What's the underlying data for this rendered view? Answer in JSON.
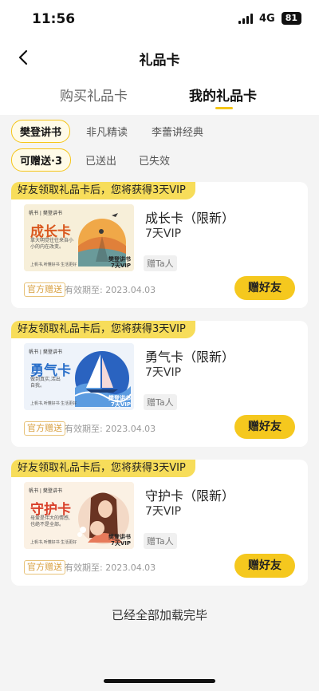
{
  "status_bar": {
    "time": "11:56",
    "network": "4G",
    "battery": "81"
  },
  "header": {
    "title": "礼品卡",
    "back_icon": "chevron-left-icon"
  },
  "main_tabs": [
    {
      "label": "购买礼品卡",
      "active": false
    },
    {
      "label": "我的礼品卡",
      "active": true
    }
  ],
  "source_filters": [
    {
      "label": "樊登讲书",
      "active": true
    },
    {
      "label": "非凡精读",
      "active": false
    },
    {
      "label": "李蕾讲经典",
      "active": false
    }
  ],
  "status_filters": [
    {
      "label": "可赠送·3",
      "active": true
    },
    {
      "label": "已送出",
      "active": false
    },
    {
      "label": "已失效",
      "active": false
    }
  ],
  "cards": [
    {
      "banner": "好友领取礼品卡后，您将获得3天VIP",
      "name": "成长卡（限新）",
      "duration": "7天VIP",
      "gift_tag": "赠Ta人",
      "official_tag": "官方赠送",
      "expiry": "有效期至: 2023.04.03",
      "button": "赠好友",
      "thumb_title": "成长卡",
      "thumb_brand": "帆书 | 樊登讲书",
      "thumb_sub": "拿大明觉往往来自小小的内在改变。",
      "thumb_corner": "樊登讲书\n7天VIP",
      "thumb_footer": "上帆书,听懂好书 生活更好",
      "accent": "#d9571e"
    },
    {
      "banner": "好友领取礼品卡后，您将获得3天VIP",
      "name": "勇气卡（限新）",
      "duration": "7天VIP",
      "gift_tag": "赠Ta人",
      "official_tag": "官方赠送",
      "expiry": "有效期至: 2023.04.03",
      "button": "赠好友",
      "thumb_title": "勇气卡",
      "thumb_brand": "帆书 | 樊登讲书",
      "thumb_sub": "做到真实,活出自我。",
      "thumb_corner": "樊登讲书\n7天VIP",
      "thumb_footer": "上帆书,听懂好书 生活更好",
      "accent": "#2a6fc9"
    },
    {
      "banner": "好友领取礼品卡后，您将获得3天VIP",
      "name": "守护卡（限新）",
      "duration": "7天VIP",
      "gift_tag": "赠Ta人",
      "official_tag": "官方赠送",
      "expiry": "有效期至: 2023.04.03",
      "button": "赠好友",
      "thumb_title": "守护卡",
      "thumb_brand": "帆书 | 樊登讲书",
      "thumb_sub": "母爱是伟大的情感,也绝不是全部。",
      "thumb_corner": "樊登讲书\n7天VIP",
      "thumb_footer": "上帆书,听懂好书 生活更好",
      "accent": "#d9402a"
    }
  ],
  "footer": "已经全部加载完毕"
}
